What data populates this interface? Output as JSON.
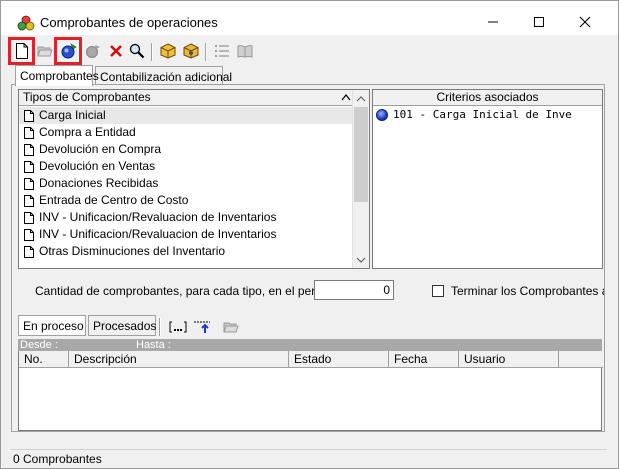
{
  "window": {
    "title": "Comprobantes de operaciones"
  },
  "toolbar": {
    "buttons": [
      {
        "name": "new-document-icon"
      },
      {
        "name": "open-folder-icon"
      },
      {
        "name": "process-icon"
      },
      {
        "name": "undo-process-icon"
      },
      {
        "name": "delete-icon"
      },
      {
        "name": "search-icon"
      },
      {
        "name": "package-icon"
      },
      {
        "name": "package-config-icon"
      },
      {
        "name": "list-icon"
      },
      {
        "name": "book-icon"
      }
    ]
  },
  "tabs": [
    {
      "label": "Comprobantes"
    },
    {
      "label": "Contabilización adicional"
    }
  ],
  "types_list": {
    "header": "Tipos de Comprobantes",
    "items": [
      "Carga Inicial",
      "Compra a Entidad",
      "Devolución en Compra",
      "Devolución en Ventas",
      "Donaciones Recibidas",
      "Entrada de Centro de Costo",
      "INV - Unificacion/Revaluacion de Inventarios",
      "INV - Unificacion/Revaluacion de Inventarios",
      "Otras Disminuciones del Inventario"
    ],
    "selected": "Carga Inicial"
  },
  "criteria": {
    "header": "Criterios asociados",
    "items": [
      "101 - Carga Inicial de Inve"
    ]
  },
  "quantity": {
    "label": "Cantidad de comprobantes, para cada tipo, en el período",
    "value": "0",
    "checkbox_label": "Terminar los Comprobantes al co"
  },
  "bottom_tabs": [
    {
      "label": "En proceso"
    },
    {
      "label": "Procesados"
    }
  ],
  "range": {
    "desde": "Desde :",
    "hasta": "Hasta :"
  },
  "grid": {
    "columns": [
      "No.",
      "Descripción",
      "Estado",
      "Fecha",
      "Usuario"
    ]
  },
  "status": {
    "text": "0 Comprobantes"
  },
  "colors": {
    "highlight": "#e0212b",
    "window_bg": "#f0f0f0"
  }
}
